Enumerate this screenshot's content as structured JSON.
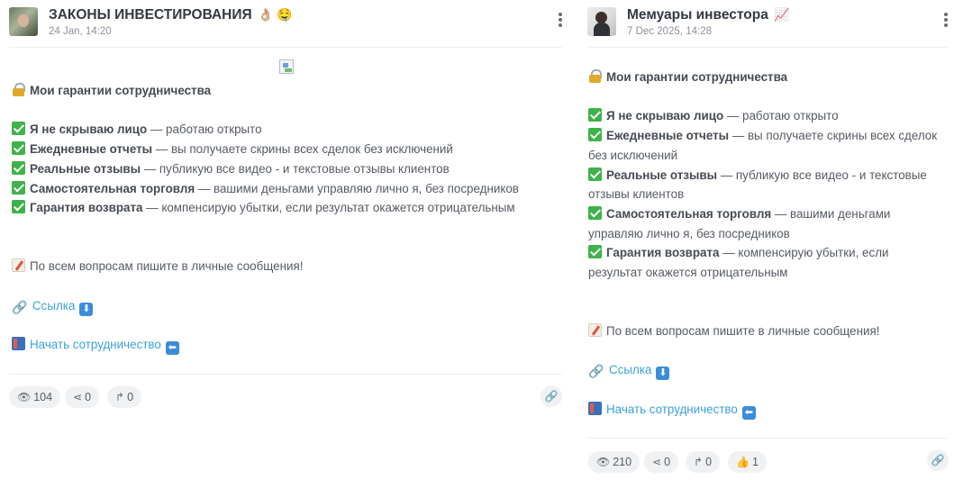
{
  "left": {
    "channel_title": "ЗАКОНЫ ИНВЕСТИРОВАНИЯ",
    "title_emojis": "👌🏼 🤤",
    "date": "24 Jan, 14:20",
    "heading": "Мои гарантии сотрудничества",
    "items": [
      {
        "bold": "Я не скрываю лицо",
        "rest": " — работаю открыто"
      },
      {
        "bold": "Ежедневные отчеты",
        "rest": " — вы получаете скрины всех сделок без исключений"
      },
      {
        "bold": "Реальные отзывы",
        "rest": " — публикую все видео - и текстовые отзывы клиентов"
      },
      {
        "bold": "Самостоятельная торговля",
        "rest": " — вашими деньгами управляю лично я, без посредников"
      },
      {
        "bold": "Гарантия возврата",
        "rest": " — компенсирую убытки, если результат окажется отрицательным"
      }
    ],
    "contact_text": "По всем вопросам пишите в личные сообщения!",
    "link_text": "Ссылка",
    "start_text": "Начать сотрудничество",
    "views": "104",
    "shares": "0",
    "forwards": "0"
  },
  "right": {
    "channel_title": "Мемуары инвестора",
    "title_emojis": "📈",
    "date": "7 Dec 2025, 14:28",
    "heading": "Мои гарантии сотрудничества",
    "items": [
      {
        "bold": "Я не скрываю лицо",
        "rest": " — работаю открыто"
      },
      {
        "bold": "Ежедневные отчеты",
        "rest": " — вы получаете скрины всех сделок без исключений"
      },
      {
        "bold": "Реальные отзывы",
        "rest": " — публикую все видео - и текстовые отзывы клиентов"
      },
      {
        "bold": "Самостоятельная торговля",
        "rest": " — вашими деньгами управляю лично я, без посредников"
      },
      {
        "bold": "Гарантия возврата",
        "rest": " — компенсирую убытки, если результат окажется отрицательным"
      }
    ],
    "contact_text": "По всем вопросам пишите в личные сообщения!",
    "link_text": "Ссылка",
    "start_text": "Начать сотрудничество",
    "views": "210",
    "shares": "0",
    "forwards": "0",
    "reactions": "1"
  },
  "icons": {
    "views": "eye-icon",
    "shares": "share-icon",
    "forwards": "forward-icon",
    "reactions": "thumbs-up-icon",
    "copy_link": "link-icon",
    "menu": "kebab-menu-icon"
  },
  "colors": {
    "link": "#3aa1d8",
    "check": "#3fb24a",
    "pill_bg": "#f0f1f3"
  }
}
